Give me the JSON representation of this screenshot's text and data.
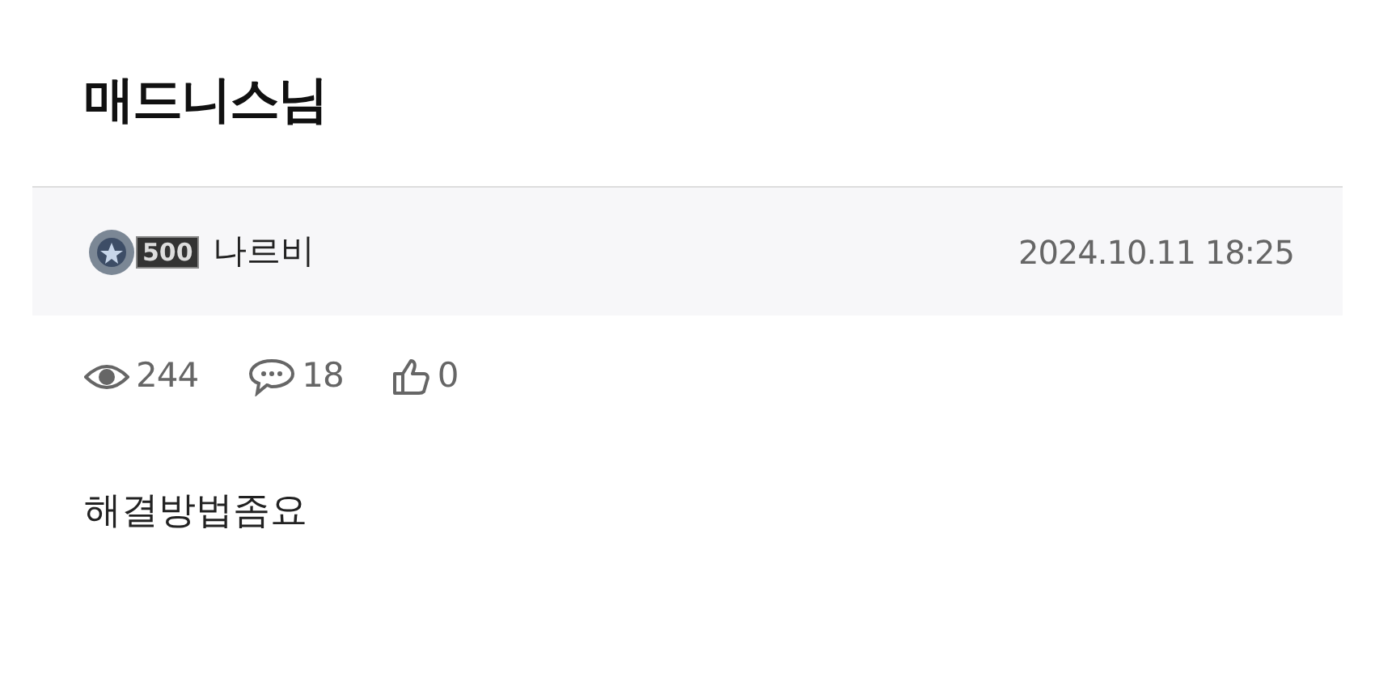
{
  "title": "매드니스님",
  "author": {
    "level": "500",
    "name": "나르비"
  },
  "date": "2024.10.11 18:25",
  "stats": {
    "views": "244",
    "comments": "18",
    "likes": "0"
  },
  "body": "해결방법좀요"
}
